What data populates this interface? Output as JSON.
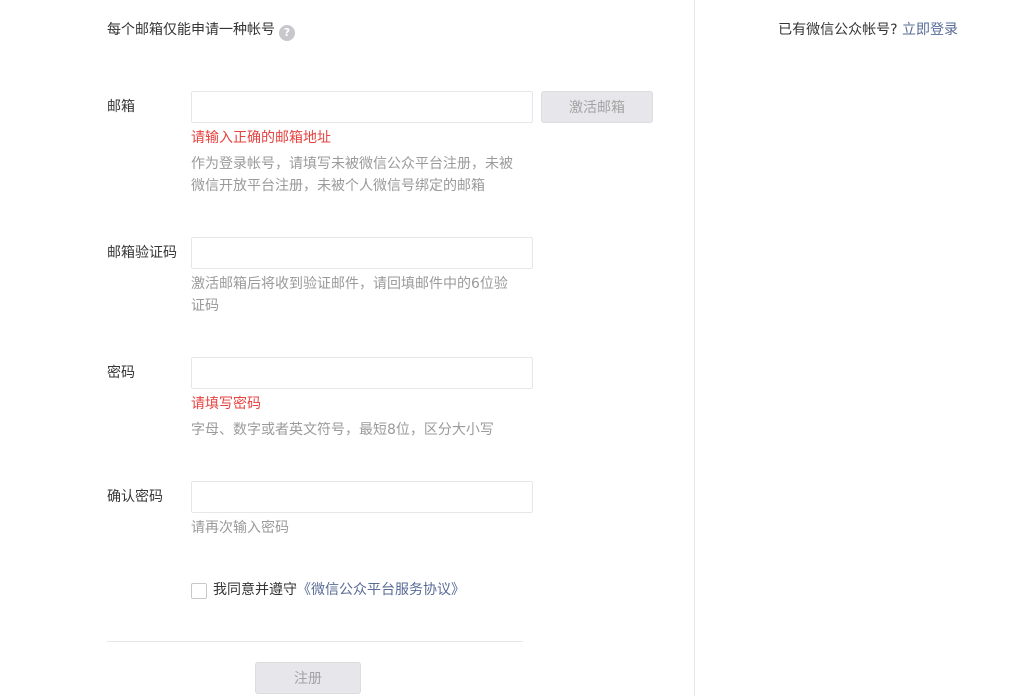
{
  "header": {
    "notice": "每个邮箱仅能申请一种帐号",
    "help_glyph": "?",
    "have_account": "已有微信公众帐号?",
    "login_link": "立即登录"
  },
  "form": {
    "email": {
      "label": "邮箱",
      "value": "",
      "activate_button": "激活邮箱",
      "error": "请输入正确的邮箱地址",
      "tip": "作为登录帐号，请填写未被微信公众平台注册，未被微信开放平台注册，未被个人微信号绑定的邮箱"
    },
    "code": {
      "label": "邮箱验证码",
      "value": "",
      "tip": "激活邮箱后将收到验证邮件，请回填邮件中的6位验证码"
    },
    "password": {
      "label": "密码",
      "value": "",
      "error": "请填写密码",
      "tip": "字母、数字或者英文符号，最短8位，区分大小写"
    },
    "confirm": {
      "label": "确认密码",
      "value": "",
      "tip": "请再次输入密码"
    },
    "agreement": {
      "checked": false,
      "text": "我同意并遵守",
      "link": "《微信公众平台服务协议》"
    },
    "submit_button": "注册"
  },
  "colors": {
    "link": "#576b95",
    "error": "#e64340",
    "tip": "#9a9a9a",
    "border": "#e7e7eb",
    "disabled_bg": "#e7e7eb"
  }
}
